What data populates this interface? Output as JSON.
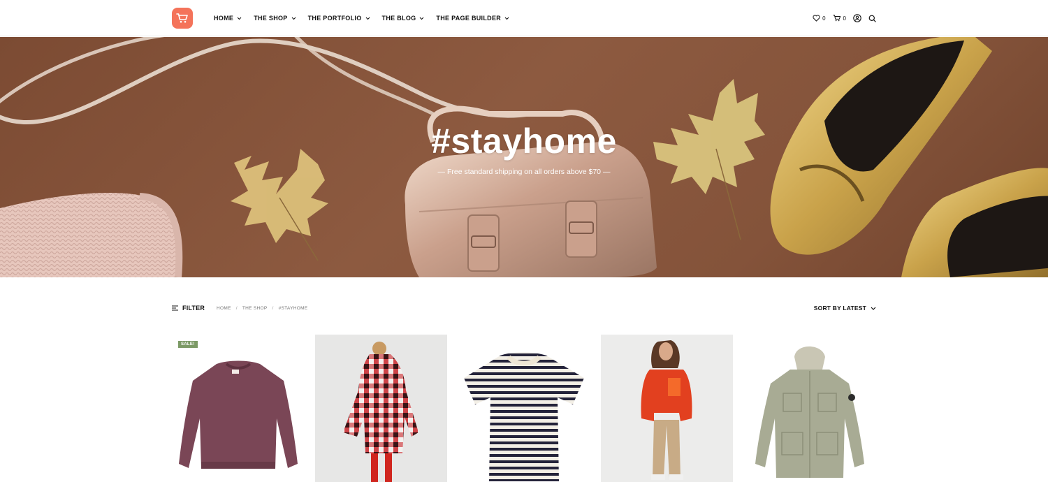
{
  "header": {
    "nav": [
      {
        "label": "HOME"
      },
      {
        "label": "THE SHOP"
      },
      {
        "label": "THE PORTFOLIO"
      },
      {
        "label": "THE BLOG"
      },
      {
        "label": "THE PAGE BUILDER"
      }
    ],
    "wishlist_count": "0",
    "cart_count": "0"
  },
  "hero": {
    "title": "#stayhome",
    "subtitle": "— Free standard shipping on all orders above $70 —"
  },
  "toolbar": {
    "filter_label": "FILTER",
    "breadcrumb": [
      "HOME",
      "THE SHOP",
      "#STAYHOME"
    ],
    "sort_label": "SORT BY LATEST"
  },
  "products": [
    {
      "badge": "SALE!",
      "item": "maroon sweatshirt"
    },
    {
      "item": "checked hooded coat"
    },
    {
      "item": "striped t-shirt"
    },
    {
      "item": "red fleece jacket"
    },
    {
      "item": "olive field jacket"
    }
  ],
  "colors": {
    "brand": "#f4735a",
    "sale_badge": "#7c9a66",
    "hero_background": "#84533a"
  }
}
